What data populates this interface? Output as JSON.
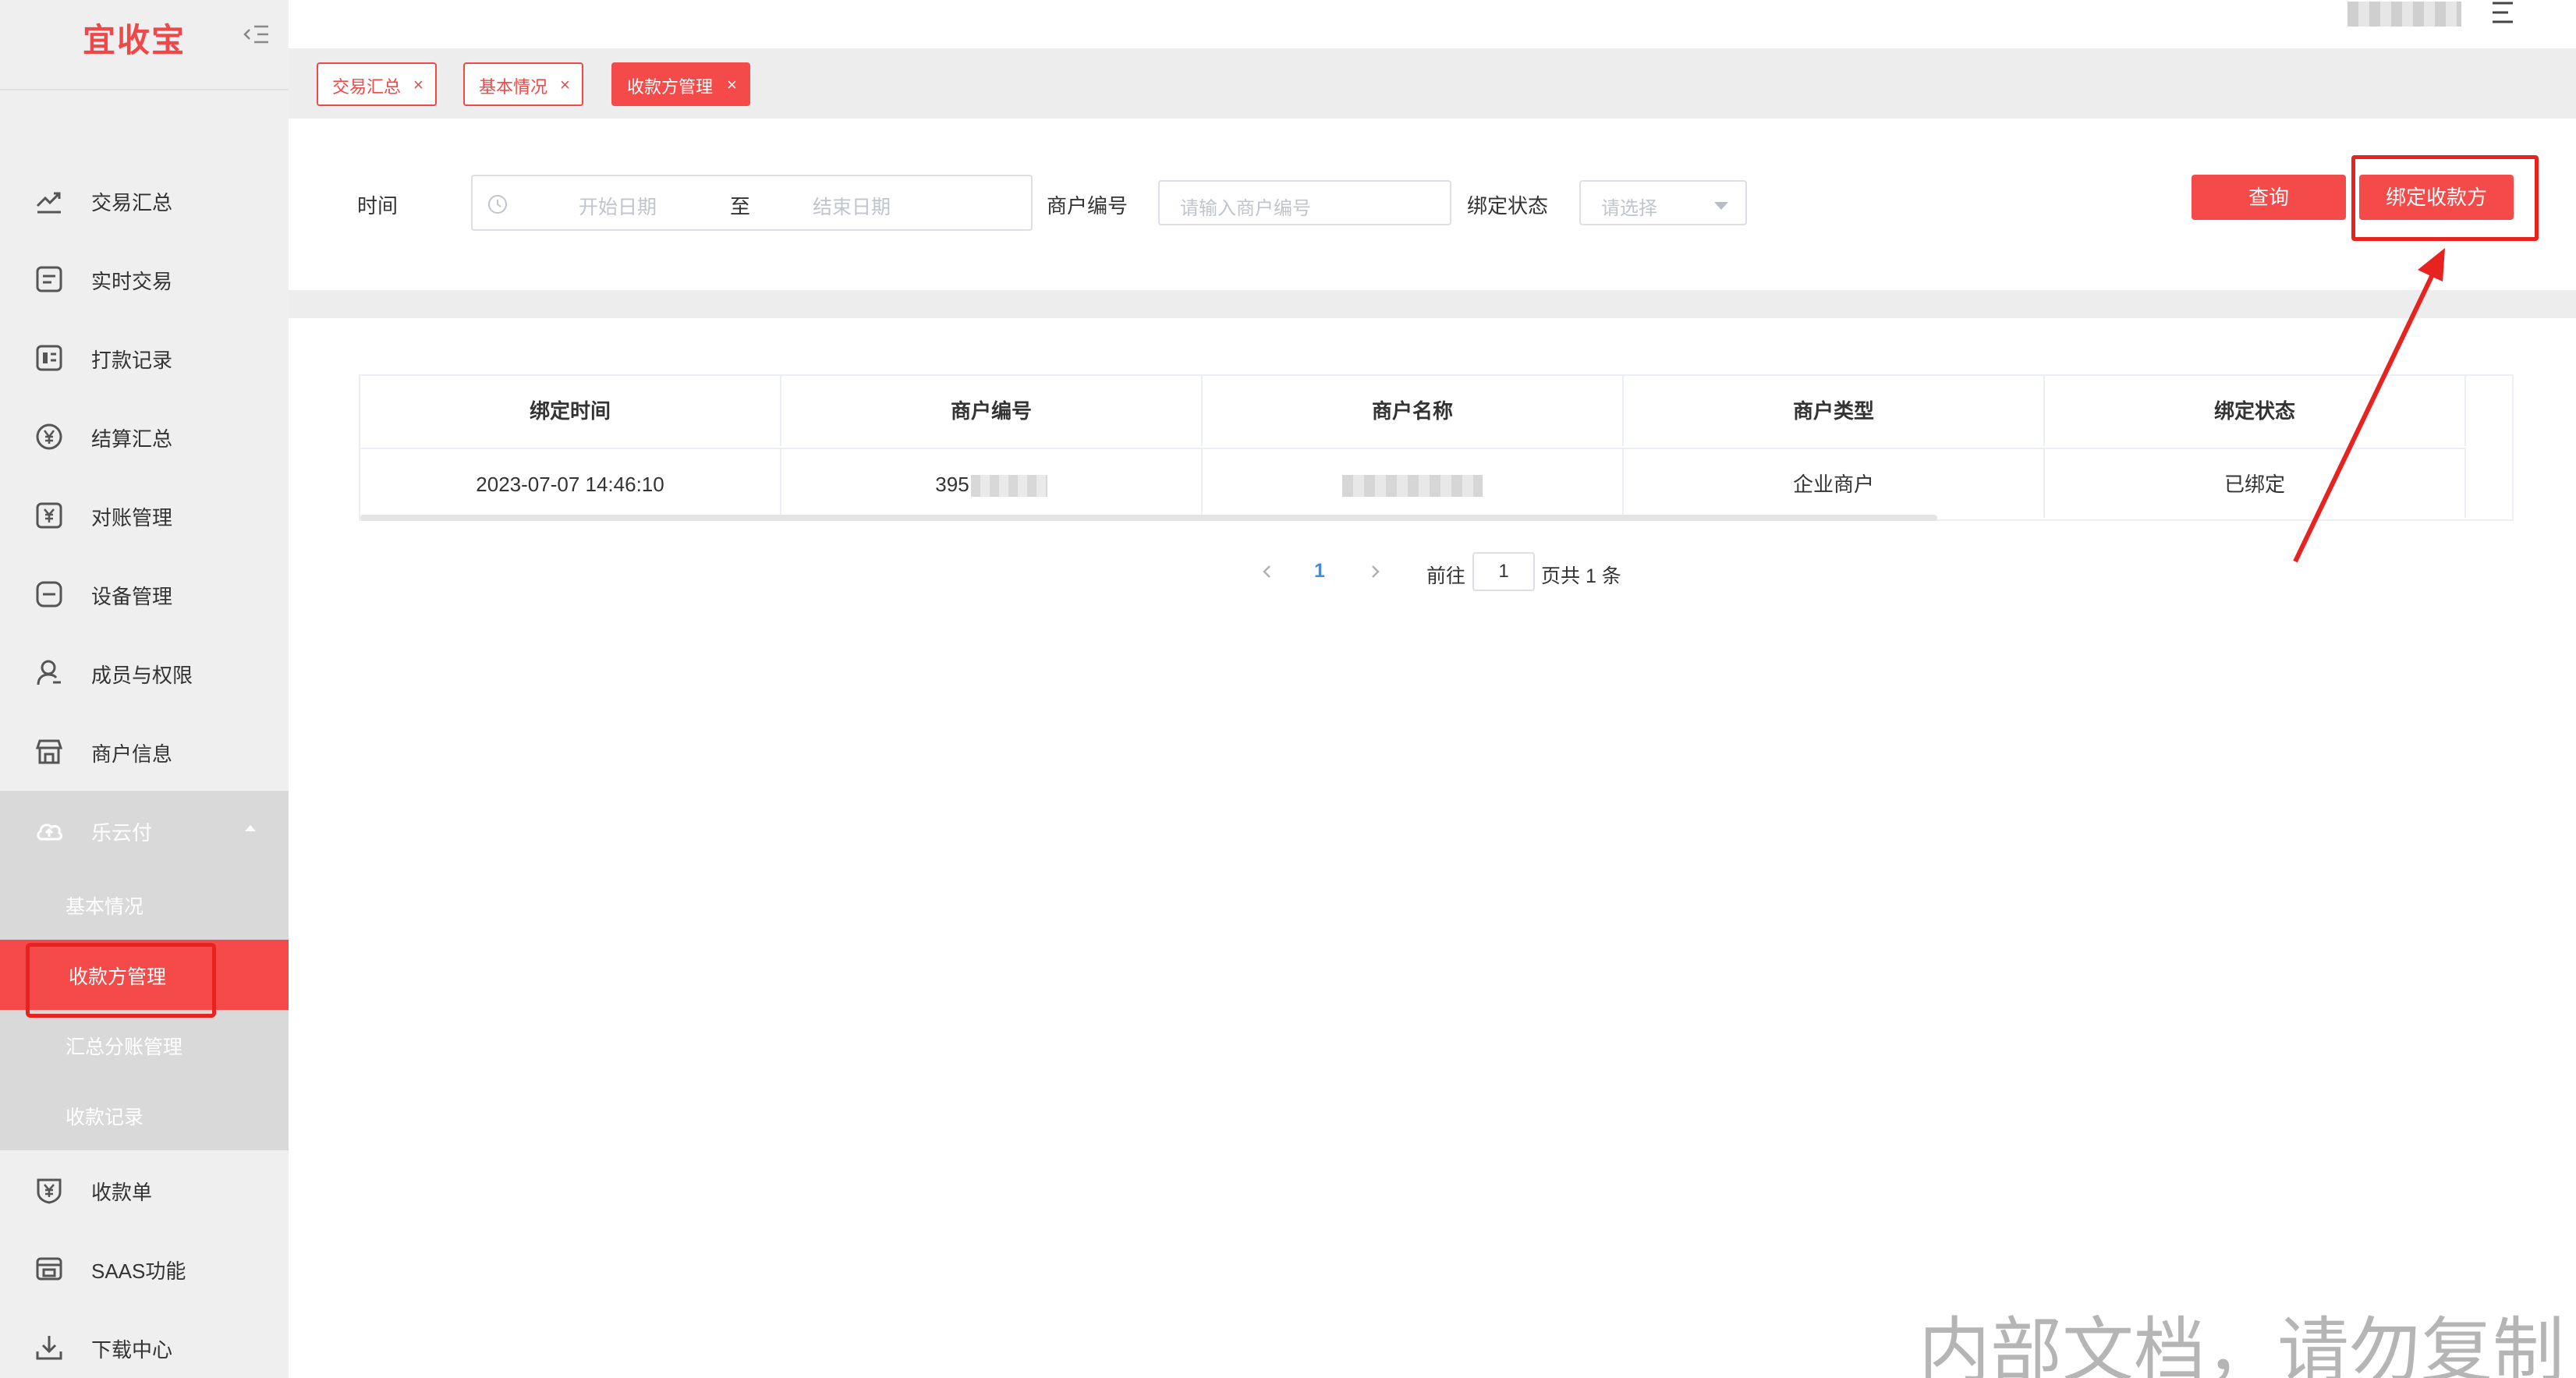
{
  "app": {
    "logo": "宜收宝"
  },
  "sidebar": {
    "items": [
      {
        "label": "交易汇总",
        "icon": "trend-chart-icon"
      },
      {
        "label": "实时交易",
        "icon": "document-list-icon"
      },
      {
        "label": "打款记录",
        "icon": "payment-record-icon"
      },
      {
        "label": "结算汇总",
        "icon": "yen-circle-icon"
      },
      {
        "label": "对账管理",
        "icon": "yen-document-icon"
      },
      {
        "label": "设备管理",
        "icon": "device-icon"
      },
      {
        "label": "成员与权限",
        "icon": "member-icon"
      },
      {
        "label": "商户信息",
        "icon": "store-icon"
      }
    ],
    "group": {
      "label": "乐云付",
      "icon": "cloud-upload-icon",
      "expanded": true,
      "children": [
        "基本情况",
        "收款方管理",
        "汇总分账管理",
        "收款记录"
      ],
      "active_child": "收款方管理"
    },
    "items_after": [
      {
        "label": "收款单",
        "icon": "receipt-shield-icon"
      },
      {
        "label": "SAAS功能",
        "icon": "saas-icon"
      },
      {
        "label": "下载中心",
        "icon": "download-icon"
      }
    ]
  },
  "tabs": [
    {
      "label": "交易汇总",
      "close": "×",
      "active": false
    },
    {
      "label": "基本情况",
      "close": "×",
      "active": false
    },
    {
      "label": "收款方管理",
      "close": "×",
      "active": true
    }
  ],
  "filters": {
    "time_label": "时间",
    "start_placeholder": "开始日期",
    "range_separator": "至",
    "end_placeholder": "结束日期",
    "merchant_no_label": "商户编号",
    "merchant_no_placeholder": "请输入商户编号",
    "bind_status_label": "绑定状态",
    "bind_status_placeholder": "请选择",
    "query_button": "查询",
    "bind_button": "绑定收款方"
  },
  "table": {
    "columns": [
      "绑定时间",
      "商户编号",
      "商户名称",
      "商户类型",
      "绑定状态"
    ],
    "rows": [
      {
        "bind_time": "2023-07-07 14:46:10",
        "merchant_no_visible": "395",
        "merchant_name": "",
        "merchant_type": "企业商户",
        "bind_status": "已绑定"
      }
    ]
  },
  "pagination": {
    "current_page": "1",
    "goto_label": "前往",
    "goto_value": "1",
    "total_text": "页共 1 条"
  },
  "watermark": "内部文档，请勿复制",
  "colors": {
    "brand": "#f44a4a",
    "annotation": "#e8231f",
    "link": "#3a8ee6"
  }
}
